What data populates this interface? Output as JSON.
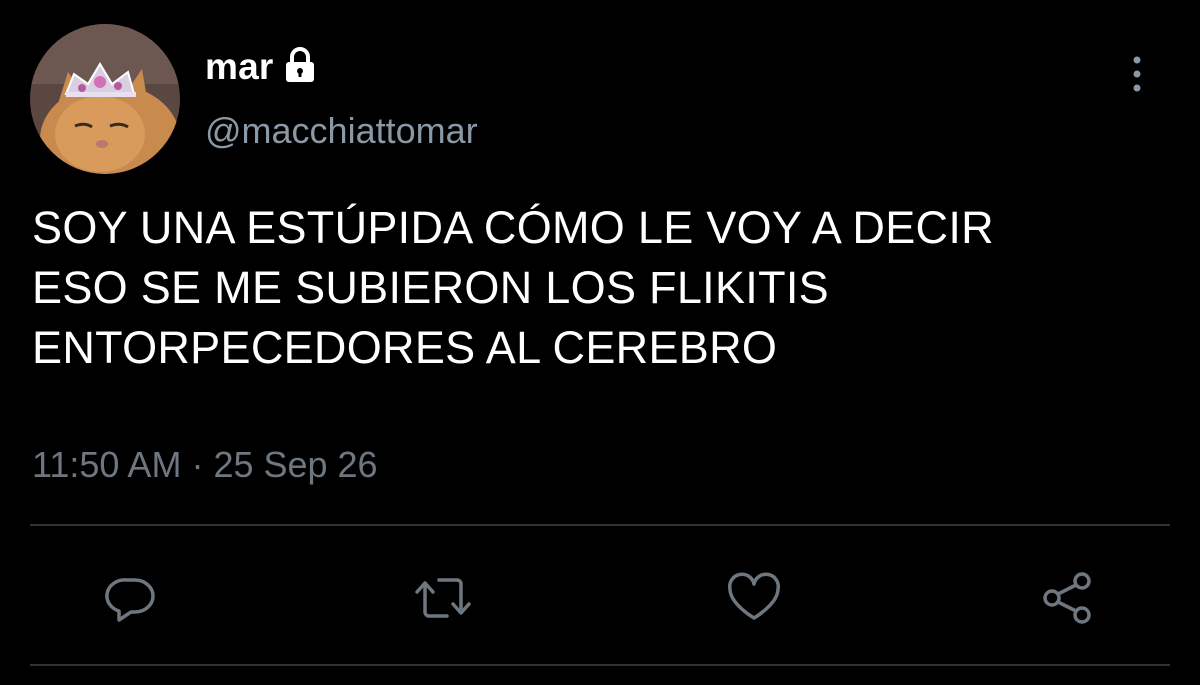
{
  "tweet": {
    "author": {
      "display_name": "mar",
      "handle": "@macchiattomar",
      "protected_icon": "lock-icon",
      "avatar_description": "avatar"
    },
    "text_lines": [
      "SOY UNA ESTÚPIDA CÓMO LE VOY A DECIR",
      "ESO SE ME SUBIERON LOS FLIKITIS",
      "ENTORPECEDORES AL CEREBRO"
    ],
    "time": "11:50 AM",
    "separator": "·",
    "date": "25 Sep 26"
  },
  "actions": [
    {
      "name": "reply",
      "icon": "comment-icon"
    },
    {
      "name": "retweet",
      "icon": "retweet-icon"
    },
    {
      "name": "like",
      "icon": "heart-icon"
    },
    {
      "name": "share",
      "icon": "share-icon"
    }
  ],
  "more_menu_icon": "more-vertical-icon",
  "colors": {
    "background": "#000000",
    "text_primary": "#ffffff",
    "text_secondary": "#8b98a5",
    "meta": "#6e7780",
    "icon": "#6e7780",
    "divider": "#2f3336"
  }
}
